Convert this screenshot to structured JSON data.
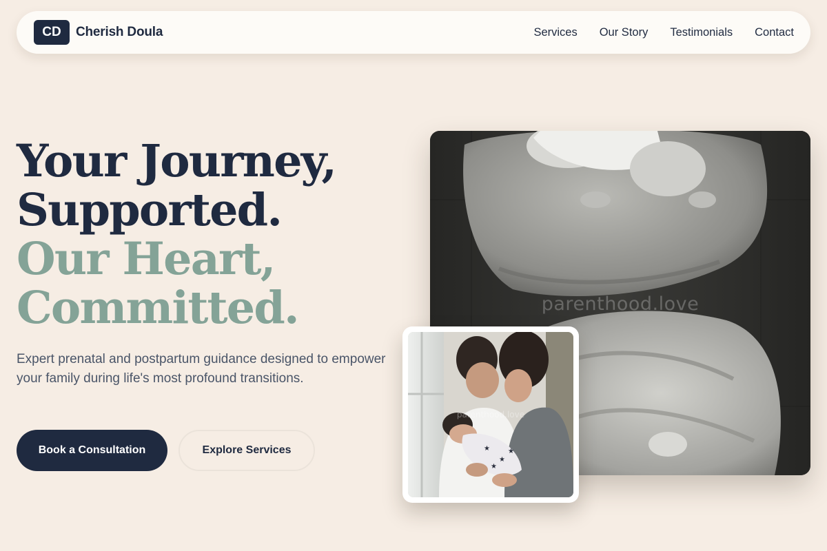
{
  "brand": {
    "logo_text": "CD",
    "name": "Cherish Doula"
  },
  "nav": {
    "links": [
      "Services",
      "Our Story",
      "Testimonials",
      "Contact"
    ]
  },
  "hero": {
    "headline_lines": [
      "Your Journey,",
      "Supported.",
      "Our Heart,",
      "Committed."
    ],
    "lead": "Expert prenatal and postpartum guidance designed to empower your family during life's most profound transitions.",
    "primary_cta": "Book a Consultation",
    "secondary_cta": "Explore Services"
  },
  "images": {
    "main_watermark": "parenthood.love",
    "inset_watermark": "parenthood.love"
  },
  "colors": {
    "background": "#f6ede4",
    "navy": "#1f2a40",
    "sage": "#84a397",
    "body_text": "#4a5568",
    "nav_bg": "#fdfbf7"
  }
}
